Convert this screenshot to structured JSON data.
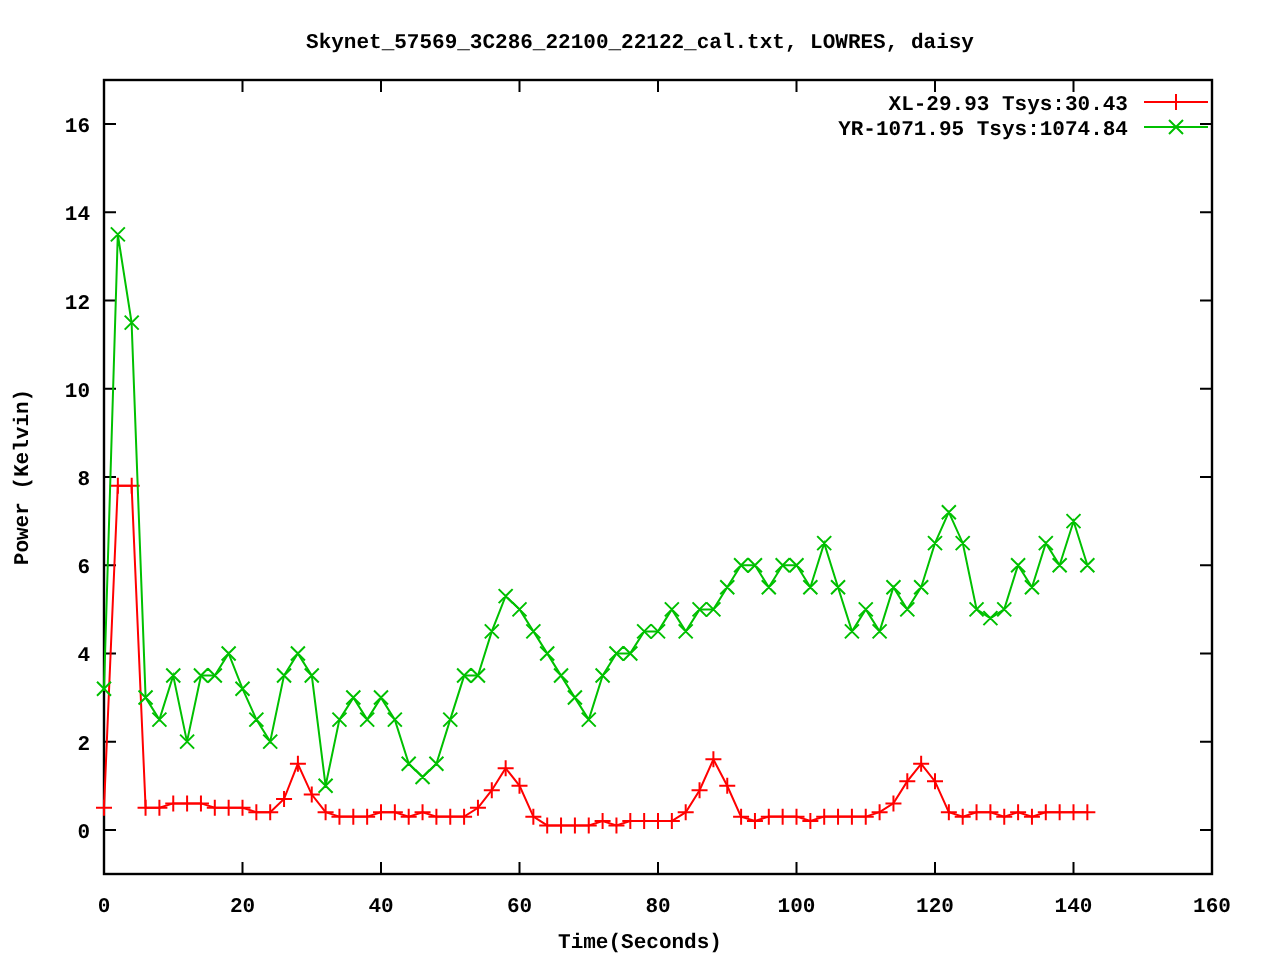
{
  "chart": {
    "chart_data": {
      "type": "line",
      "title": "Skynet_57569_3C286_22100_22122_cal.txt, LOWRES, daisy",
      "xlabel": "Time(Seconds)",
      "ylabel": "Power (Kelvin)",
      "x": [
        0,
        2,
        4,
        6,
        8,
        10,
        12,
        14,
        16,
        18,
        20,
        22,
        24,
        26,
        28,
        30,
        32,
        34,
        36,
        38,
        40,
        42,
        44,
        46,
        48,
        50,
        52,
        54,
        56,
        58,
        60,
        62,
        64,
        66,
        68,
        70,
        72,
        74,
        76,
        78,
        80,
        82,
        84,
        86,
        88,
        90,
        92,
        94,
        96,
        98,
        100,
        102,
        104,
        106,
        108,
        110,
        112,
        114,
        116,
        118,
        120,
        122,
        124,
        126,
        128,
        130,
        132,
        134,
        136,
        138,
        140,
        142
      ],
      "series": [
        {
          "name": "XL-29.93 Tsys:30.43",
          "color": "#ff0000",
          "marker": "plus",
          "values": [
            0.5,
            7.8,
            7.8,
            0.5,
            0.5,
            0.6,
            0.6,
            0.6,
            0.5,
            0.5,
            0.5,
            0.4,
            0.4,
            0.7,
            1.5,
            0.8,
            0.4,
            0.3,
            0.3,
            0.3,
            0.4,
            0.4,
            0.3,
            0.4,
            0.3,
            0.3,
            0.3,
            0.5,
            0.9,
            1.4,
            1.0,
            0.3,
            0.1,
            0.1,
            0.1,
            0.1,
            0.2,
            0.1,
            0.2,
            0.2,
            0.2,
            0.2,
            0.4,
            0.9,
            1.6,
            1.0,
            0.3,
            0.2,
            0.3,
            0.3,
            0.3,
            0.2,
            0.3,
            0.3,
            0.3,
            0.3,
            0.4,
            0.6,
            1.1,
            1.5,
            1.1,
            0.4,
            0.3,
            0.4,
            0.4,
            0.3,
            0.4,
            0.3,
            0.4,
            0.4,
            0.4,
            0.4
          ]
        },
        {
          "name": "YR-1071.95 Tsys:1074.84",
          "color": "#00c000",
          "marker": "cross",
          "values": [
            3.2,
            13.5,
            11.5,
            3.0,
            2.5,
            3.5,
            2.0,
            3.5,
            3.5,
            4.0,
            3.2,
            2.5,
            2.0,
            3.5,
            4.0,
            3.5,
            1.0,
            2.5,
            3.0,
            2.5,
            3.0,
            2.5,
            1.5,
            1.2,
            1.5,
            2.5,
            3.5,
            3.5,
            4.5,
            5.3,
            5.0,
            4.5,
            4.0,
            3.5,
            3.0,
            2.5,
            3.5,
            4.0,
            4.0,
            4.5,
            4.5,
            5.0,
            4.5,
            5.0,
            5.0,
            5.5,
            6.0,
            6.0,
            5.5,
            6.0,
            6.0,
            5.5,
            6.5,
            5.5,
            4.5,
            5.0,
            4.5,
            5.5,
            5.0,
            5.5,
            6.5,
            7.2,
            6.5,
            5.0,
            4.8,
            5.0,
            6.0,
            5.5,
            6.5,
            6.0,
            7.0,
            6.0
          ]
        }
      ],
      "legend": true,
      "xlim": [
        0,
        160
      ],
      "ylim": [
        -1,
        17
      ],
      "xticks": [
        0,
        20,
        40,
        60,
        80,
        100,
        120,
        140,
        160
      ],
      "yticks": [
        0,
        2,
        4,
        6,
        8,
        10,
        12,
        14,
        16
      ]
    }
  }
}
